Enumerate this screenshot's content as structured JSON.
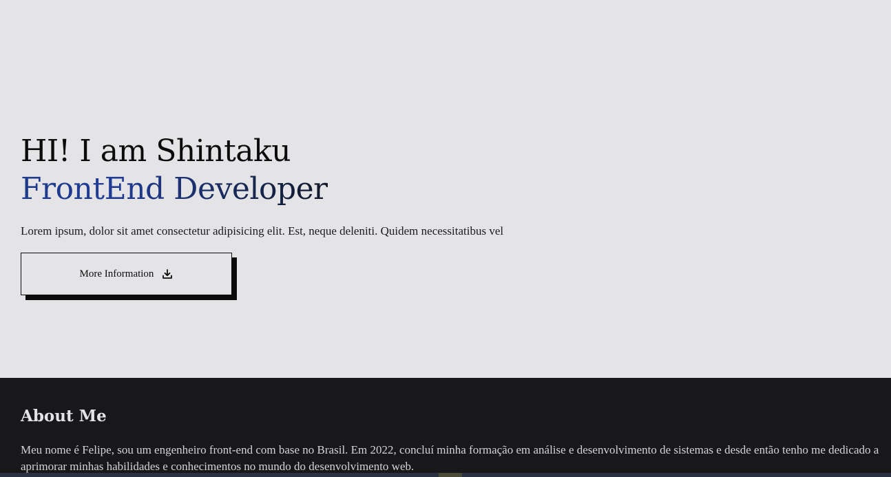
{
  "hero": {
    "greeting": "HI! I am Shintaku",
    "role": "FrontEnd Developer",
    "description": "Lorem ipsum, dolor sit amet consectetur adipisicing elit. Est, neque deleniti. Quidem necessitatibus vel",
    "button_label": "More Information",
    "button_icon": "download-icon"
  },
  "about": {
    "title": "About Me",
    "text": "Meu nome é Felipe, sou um engenheiro front-end com base no Brasil. Em 2022, concluí minha formação em análise e desenvolvimento de sistemas e desde então tenho me dedicado a aprimorar minhas habilidades e conhecimentos no mundo do desenvolvimento web."
  },
  "colors": {
    "hero_background": "#e4e4e7",
    "about_background": "#18181b",
    "accent_blue": "#1e3a8a",
    "text_dark": "#0b0b0c"
  }
}
